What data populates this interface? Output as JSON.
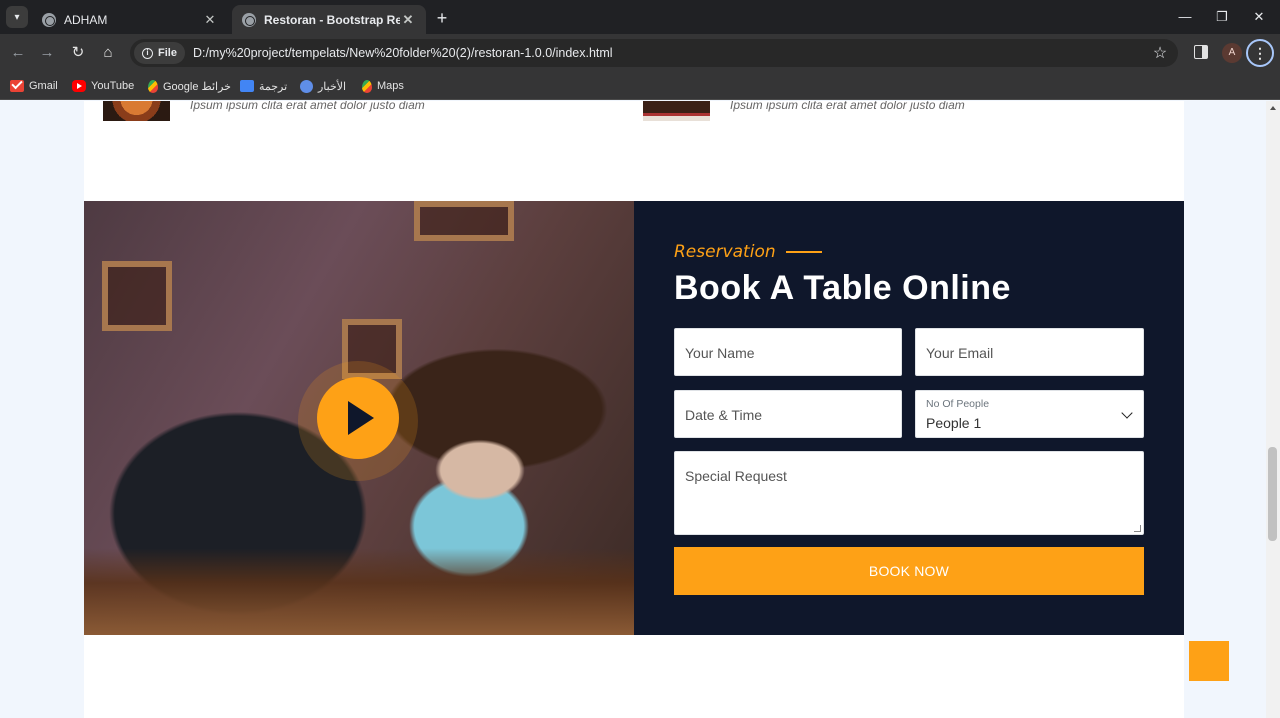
{
  "browser": {
    "tabs": [
      {
        "title": "ADHAM",
        "active": false
      },
      {
        "title": "Restoran - Bootstrap Restaurant",
        "active": true
      }
    ],
    "new_tab_glyph": "+",
    "url_chip": "File",
    "url": "D:/my%20project/tempelats/New%20folder%20(2)/restoran-1.0.0/index.html",
    "profile_initial": "A",
    "bookmarks": [
      {
        "label": "Gmail",
        "icon": "gmail-icon"
      },
      {
        "label": "YouTube",
        "icon": "youtube-icon"
      },
      {
        "label": "Google خرائط",
        "icon": "maps-pin-icon"
      },
      {
        "label": "ترجمة",
        "icon": "translate-icon"
      },
      {
        "label": "الأخبار",
        "icon": "news-icon"
      },
      {
        "label": "Maps",
        "icon": "maps-pin-icon"
      }
    ]
  },
  "menu_items": [
    {
      "description": "Ipsum ipsum clita erat amet dolor justo diam"
    },
    {
      "description": "Ipsum ipsum clita erat amet dolor justo diam"
    }
  ],
  "reservation": {
    "subtitle": "Reservation",
    "title": "Book A Table Online",
    "fields": {
      "name_placeholder": "Your Name",
      "email_placeholder": "Your Email",
      "datetime_placeholder": "Date & Time",
      "people_label": "No Of People",
      "people_value": "People 1",
      "request_placeholder": "Special Request"
    },
    "submit_label": "BOOK NOW"
  },
  "colors": {
    "accent": "#fea116",
    "dark": "#0f172b",
    "page_bg": "#f1f6fd"
  }
}
